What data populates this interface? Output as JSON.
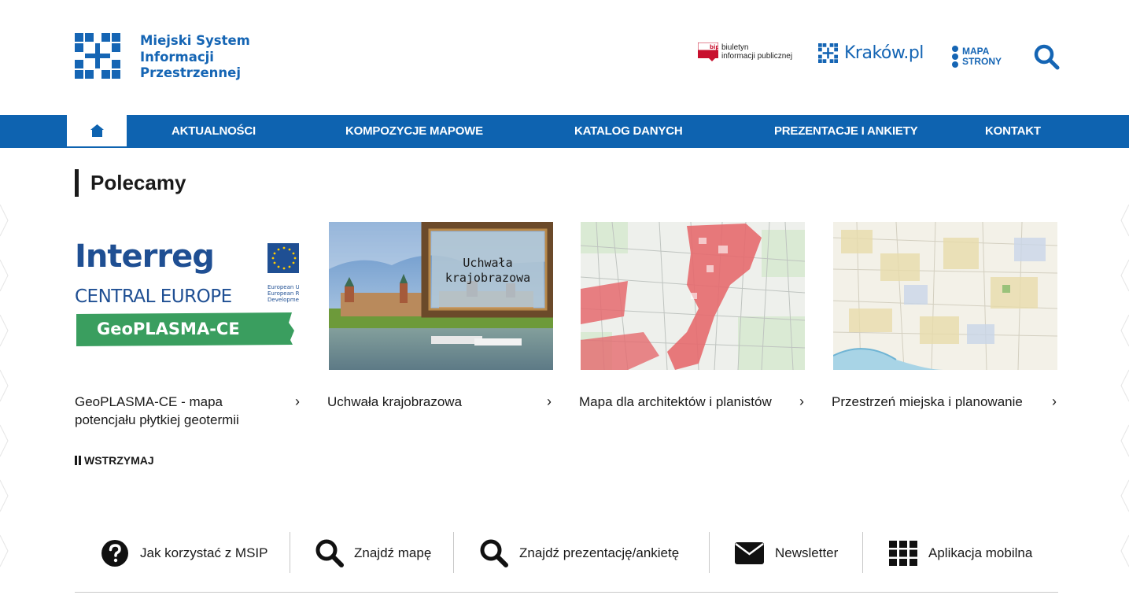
{
  "header": {
    "logo_lines": [
      "Miejski System",
      "Informacji",
      "Przestrzennej"
    ],
    "bip_line1": "biuletyn",
    "bip_line2": "informacji publicznej",
    "bip_badge": "bip",
    "krakow": "Kraków.pl",
    "mapa_line1": "MAPA",
    "mapa_line2": "STRONY"
  },
  "nav": {
    "items": [
      "AKTUALNOŚCI",
      "KOMPOZYCJE MAPOWE",
      "KATALOG DANYCH",
      "PREZENTACJE I ANKIETY",
      "KONTAKT"
    ]
  },
  "section": {
    "title": "Polecamy"
  },
  "cards": [
    {
      "title": "GeoPLASMA-CE - mapa potencjału płytkiej geotermii",
      "logo_line1": "Interreg",
      "logo_line2": "CENTRAL EUROPE",
      "logo_banner": "GeoPLASMA-CE",
      "eu_line1": "European U",
      "eu_line2": "European Re",
      "eu_line3": "Development"
    },
    {
      "title": "Uchwała krajobrazowa",
      "frame_line1": "Uchwała",
      "frame_line2": "krajobrazowa"
    },
    {
      "title": "Mapa dla architektów i planistów"
    },
    {
      "title": "Przestrzeń miejska i planowanie"
    }
  ],
  "carousel": {
    "pause_label": "WSTRZYMAJ"
  },
  "links": [
    {
      "label": "Jak korzystać z MSIP",
      "icon": "help-icon"
    },
    {
      "label": "Znajdź mapę",
      "icon": "search-icon"
    },
    {
      "label": "Znajdź prezentację/ankietę",
      "icon": "search-icon"
    },
    {
      "label": "Newsletter",
      "icon": "envelope-icon"
    },
    {
      "label": "Aplikacja mobilna",
      "icon": "grid-icon"
    }
  ],
  "colors": {
    "brand_blue": "#0e63b0",
    "text": "#1a1a1a",
    "bip_red": "#c8102e",
    "interreg_green": "#3a9e5f"
  }
}
